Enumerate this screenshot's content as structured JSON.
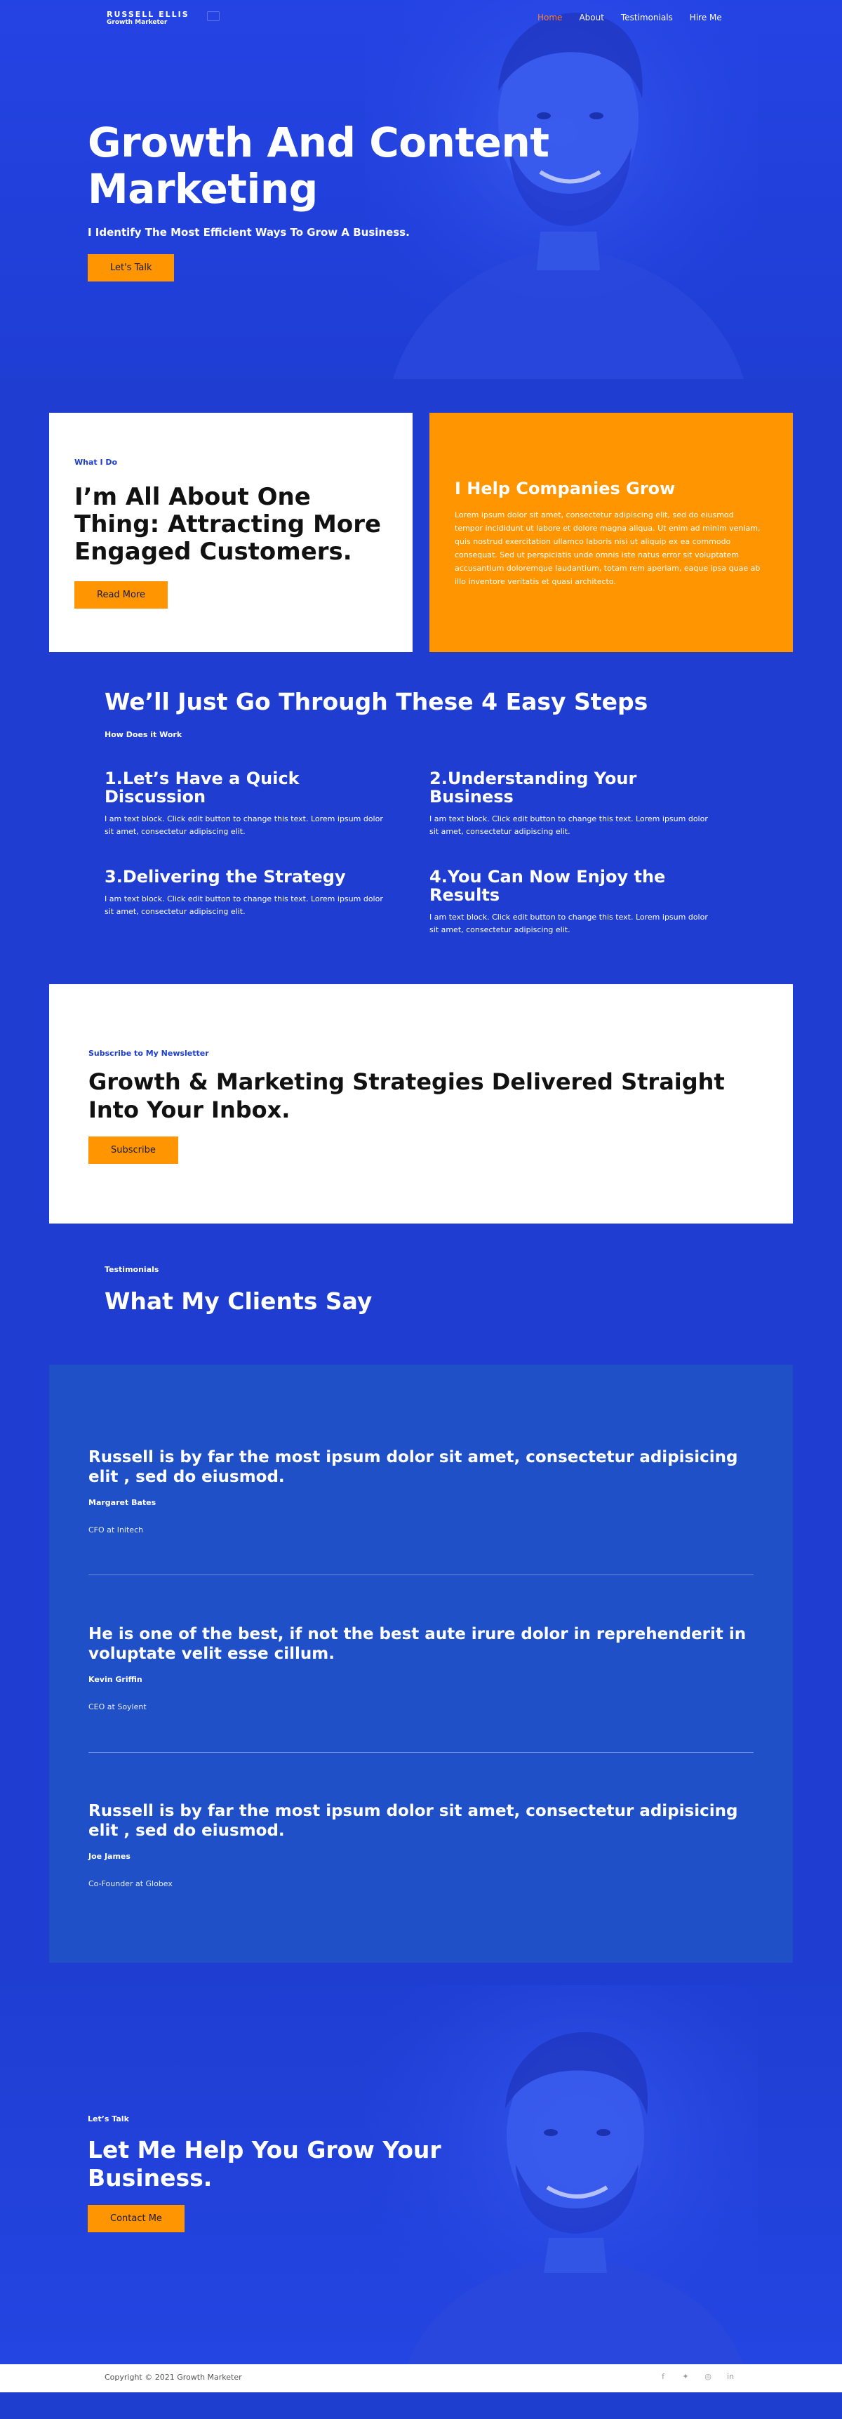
{
  "brand": {
    "name": "RUSSELL ELLIS",
    "tagline": "Growth Marketer"
  },
  "nav": {
    "items": [
      {
        "label": "Home",
        "active": true
      },
      {
        "label": "About"
      },
      {
        "label": "Testimonials"
      },
      {
        "label": "Hire Me"
      }
    ]
  },
  "hero": {
    "title_line1": "Growth And Content",
    "title_line2": "Marketing",
    "subtitle": "I Identify The Most Efficient Ways To Grow A Business.",
    "button": "Let's Talk"
  },
  "about": {
    "eyebrow": "What I Do",
    "title": "I’m All About One Thing: Attracting More Engaged Customers.",
    "button": "Read More"
  },
  "help": {
    "title": "I Help Companies Grow",
    "text": "Lorem ipsum dolor sit amet, consectetur adipiscing elit, sed do eiusmod tempor incididunt ut labore et dolore magna aliqua. Ut enim ad minim veniam, quis nostrud exercitation ullamco laboris nisi ut aliquip ex ea commodo consequat. Sed ut perspiciatis unde omnis iste natus error sit voluptatem accusantium doloremque laudantium, totam rem aperiam, eaque ipsa quae ab illo inventore veritatis et quasi architecto."
  },
  "steps": {
    "title": "We’ll Just Go Through These 4 Easy Steps",
    "eyebrow": "How Does it Work",
    "items": [
      {
        "title": "1.Let’s Have a Quick Discussion",
        "text": "I am text block. Click edit button to change this text. Lorem ipsum dolor sit amet, consectetur adipiscing elit."
      },
      {
        "title": "2.Understanding Your Business",
        "text": "I am text block. Click edit button to change this text. Lorem ipsum dolor sit amet, consectetur adipiscing elit."
      },
      {
        "title": "3.Delivering the Strategy",
        "text": "I am text block. Click edit button to change this text. Lorem ipsum dolor sit amet, consectetur adipiscing elit."
      },
      {
        "title": "4.You Can Now Enjoy the Results",
        "text": "I am text block. Click edit button to change this text. Lorem ipsum dolor sit amet, consectetur adipiscing elit."
      }
    ]
  },
  "newsletter": {
    "eyebrow": "Subscribe to My Newsletter",
    "title": "Growth & Marketing Strategies Delivered Straight Into Your Inbox.",
    "button": "Subscribe"
  },
  "testimonials": {
    "eyebrow": "Testimonials",
    "title": "What My Clients Say",
    "items": [
      {
        "quote": "Russell is by far the most ipsum dolor sit amet, consectetur adipisicing elit , sed do eiusmod.",
        "name": "Margaret Bates",
        "role": "CFO at Initech"
      },
      {
        "quote": "He is one of the best, if not the best aute irure dolor in reprehenderit in voluptate velit esse cillum.",
        "name": "Kevin Griffin",
        "role": "CEO at Soylent"
      },
      {
        "quote": "Russell is by far the most ipsum dolor sit amet, consectetur adipisicing elit , sed do eiusmod.",
        "name": "Joe James",
        "role": "Co-Founder at Globex"
      }
    ]
  },
  "cta": {
    "eyebrow": "Let’s Talk",
    "title": "Let Me Help You Grow Your Business.",
    "button": "Contact Me"
  },
  "footer": {
    "copyright": "Copyright © 2021 Growth Marketer",
    "social": [
      "facebook-icon",
      "twitter-icon",
      "instagram-icon",
      "linkedin-icon"
    ]
  },
  "colors": {
    "primary_blue": "#1f3dd1",
    "panel_blue": "#1f50c8",
    "accent_orange": "#ff9500",
    "active_nav": "#ff7a2e"
  }
}
